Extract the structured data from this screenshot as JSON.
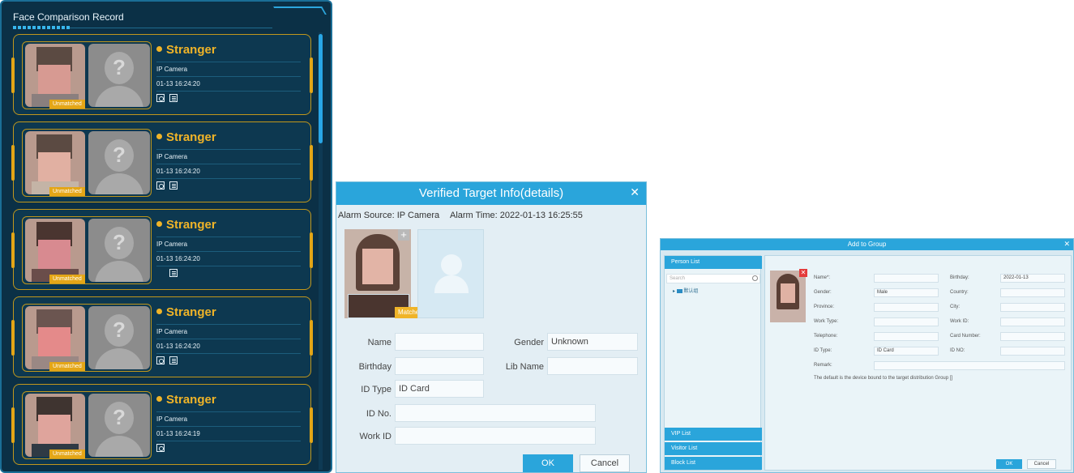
{
  "record_panel": {
    "title": "Face Comparison Record",
    "cards": [
      {
        "name": "Stranger",
        "camera": "IP Camera",
        "time": "01-13 16:24:20",
        "badge": "Unmatched"
      },
      {
        "name": "Stranger",
        "camera": "IP Camera",
        "time": "01-13 16:24:20",
        "badge": "Unmatched"
      },
      {
        "name": "Stranger",
        "camera": "IP Camera",
        "time": "01-13 16:24:20",
        "badge": "Unmatched"
      },
      {
        "name": "Stranger",
        "camera": "IP Camera",
        "time": "01-13 16:24:20",
        "badge": "Unmatched"
      },
      {
        "name": "Stranger",
        "camera": "IP Camera",
        "time": "01-13 16:24:19",
        "badge": "Unmatched"
      }
    ]
  },
  "verified_dialog": {
    "title": "Verified Target Info(details)",
    "alarm_source": "Alarm Source: IP Camera",
    "alarm_time": "Alarm Time: 2022-01-13 16:25:55",
    "badge": "Matched",
    "labels": {
      "name": "Name",
      "gender": "Gender",
      "birthday": "Birthday",
      "lib_name": "Lib Name",
      "id_type": "ID Type",
      "id_no": "ID No.",
      "work_id": "Work ID"
    },
    "values": {
      "name": "",
      "gender": "Unknown",
      "birthday": "",
      "lib_name": "",
      "id_type": "ID Card",
      "id_no": "",
      "work_id": ""
    },
    "ok": "OK",
    "cancel": "Cancel"
  },
  "group_dialog": {
    "title": "Add to Group",
    "sidebar": {
      "person_list": "Person List",
      "search_placeholder": "Search",
      "tree_item": "默认组",
      "vip_list": "VIP List",
      "visitor_list": "Visitor List",
      "block_list": "Block List"
    },
    "labels": {
      "name": "Name*:",
      "birthday": "Birthday:",
      "gender": "Gender:",
      "country": "Country:",
      "province": "Province:",
      "city": "City:",
      "work_type": "Work Type:",
      "work_id": "Work ID:",
      "telephone": "Telephone:",
      "card_number": "Card Number:",
      "id_type": "ID Type:",
      "id_no": "ID NO:",
      "remark": "Remark:"
    },
    "values": {
      "birthday": "2022-01-13",
      "gender": "Male",
      "id_type": "ID Card"
    },
    "note": "The default is the device bound to the target distribution Group []",
    "ok": "OK",
    "cancel": "Cancel"
  }
}
